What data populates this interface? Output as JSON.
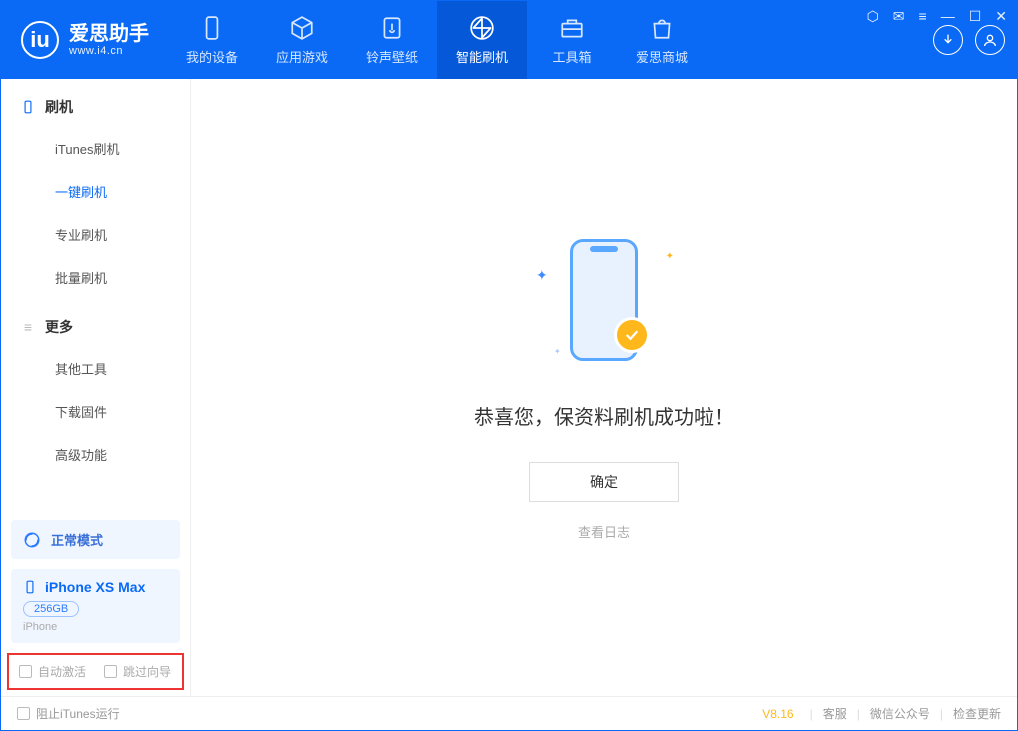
{
  "app": {
    "title": "爱思助手",
    "subtitle": "www.i4.cn"
  },
  "nav": {
    "items": [
      {
        "label": "我的设备"
      },
      {
        "label": "应用游戏"
      },
      {
        "label": "铃声壁纸"
      },
      {
        "label": "智能刷机"
      },
      {
        "label": "工具箱"
      },
      {
        "label": "爱思商城"
      }
    ]
  },
  "sidebar": {
    "group1_title": "刷机",
    "items1": [
      {
        "label": "iTunes刷机"
      },
      {
        "label": "一键刷机"
      },
      {
        "label": "专业刷机"
      },
      {
        "label": "批量刷机"
      }
    ],
    "group2_title": "更多",
    "items2": [
      {
        "label": "其他工具"
      },
      {
        "label": "下载固件"
      },
      {
        "label": "高级功能"
      }
    ],
    "mode": "正常模式",
    "device_name": "iPhone XS Max",
    "storage": "256GB",
    "device_type": "iPhone",
    "opt_auto_activate": "自动激活",
    "opt_skip_guide": "跳过向导"
  },
  "main": {
    "message": "恭喜您，保资料刷机成功啦！",
    "ok": "确定",
    "log_link": "查看日志"
  },
  "status": {
    "block_itunes": "阻止iTunes运行",
    "version": "V8.16",
    "link1": "客服",
    "link2": "微信公众号",
    "link3": "检查更新"
  }
}
